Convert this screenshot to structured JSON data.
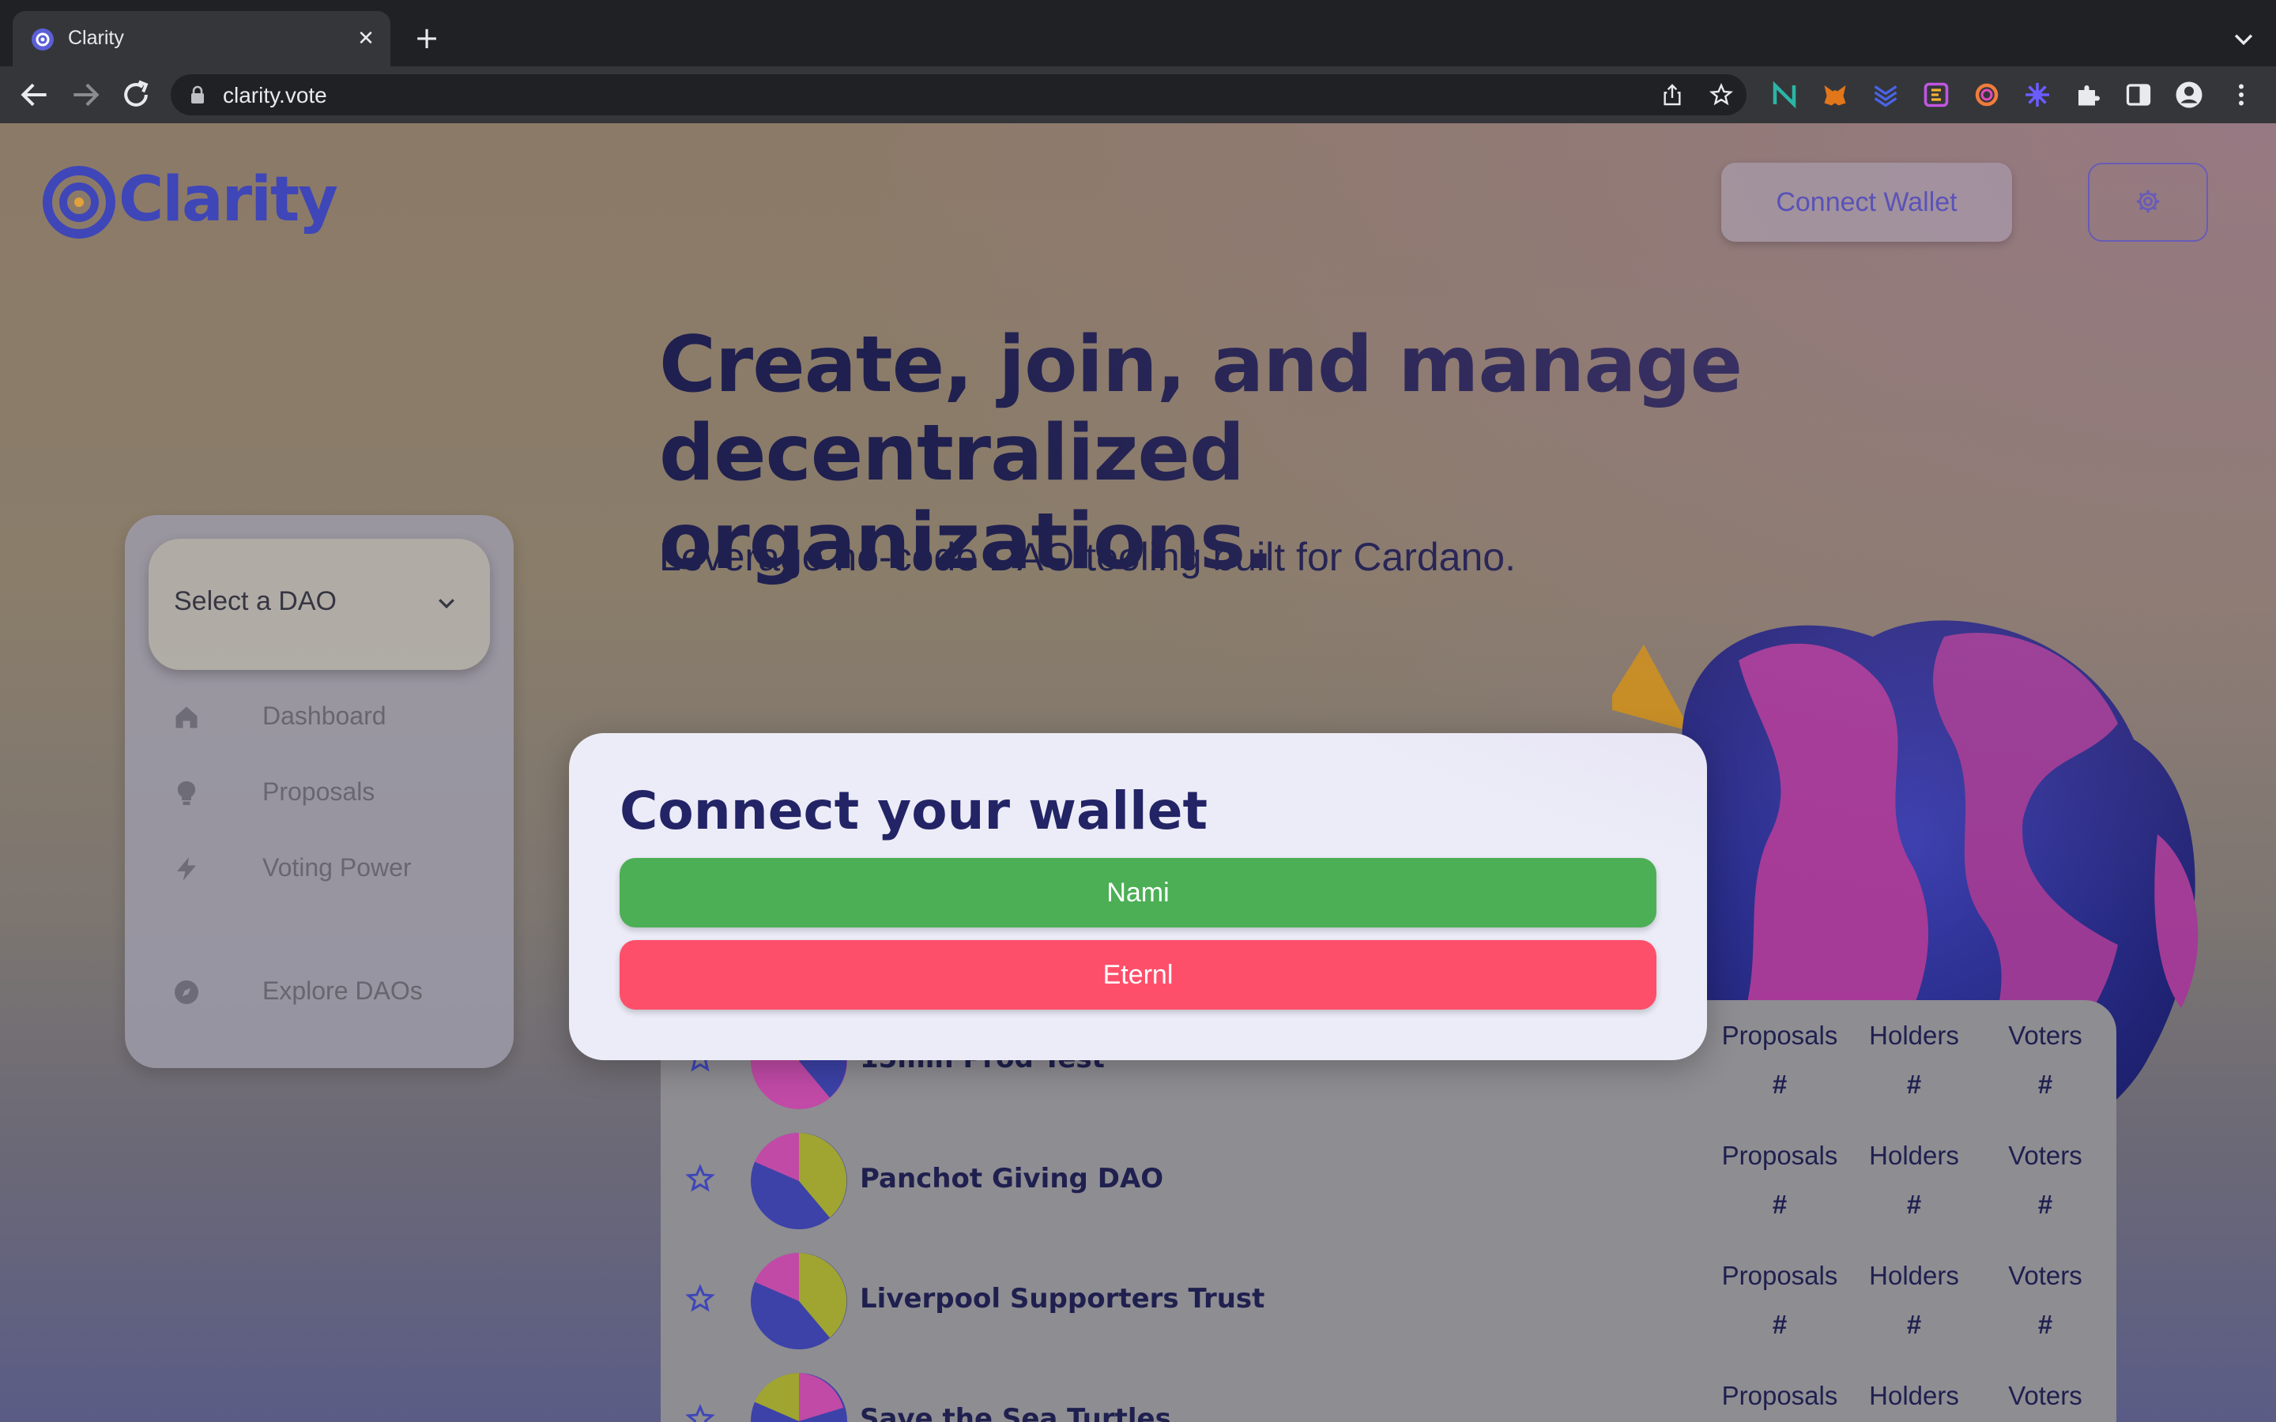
{
  "browser": {
    "tab_title": "Clarity",
    "url": "clarity.vote"
  },
  "header": {
    "logo_text": "Clarity",
    "connect_wallet_label": "Connect Wallet"
  },
  "hero": {
    "title_line1": "Create, join, and manage",
    "title_line2": "decentralized organizations.",
    "subtitle": "Leverage no-code DAO tooling built for Cardano."
  },
  "sidebar": {
    "select_placeholder": "Select a DAO",
    "items": [
      {
        "label": "Dashboard",
        "icon": "home-icon"
      },
      {
        "label": "Proposals",
        "icon": "lightbulb-icon"
      },
      {
        "label": "Voting Power",
        "icon": "lightning-icon"
      },
      {
        "label": "Explore DAOs",
        "icon": "compass-icon"
      }
    ]
  },
  "dao_list": {
    "stat_labels": {
      "proposals": "Proposals",
      "holders": "Holders",
      "voters": "Voters"
    },
    "stat_placeholder": "#",
    "rows": [
      {
        "name": "15min Prod Test"
      },
      {
        "name": "Panchot Giving DAO"
      },
      {
        "name": "Liverpool Supporters Trust"
      },
      {
        "name": "Save the Sea Turtles"
      }
    ]
  },
  "modal": {
    "title": "Connect your wallet",
    "wallets": [
      {
        "label": "Nami",
        "color": "#4caf55"
      },
      {
        "label": "Eternl",
        "color": "#fe4f6a"
      }
    ]
  },
  "colors": {
    "brand": "#3f46b8",
    "text_dark": "#1f204f"
  }
}
